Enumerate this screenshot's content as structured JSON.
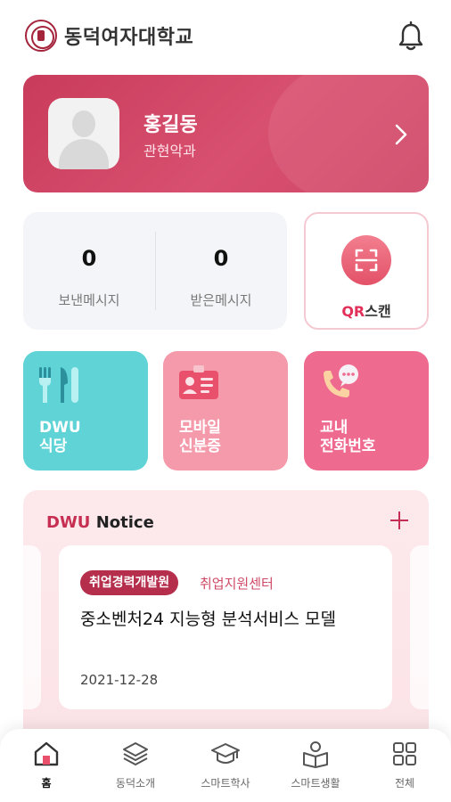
{
  "header": {
    "title": "동덕여자대학교",
    "logo": "university-seal",
    "bell_icon": "bell-icon"
  },
  "profile": {
    "name": "홍길동",
    "department": "관현악과",
    "color": "#d0476a"
  },
  "messages": {
    "sent": {
      "count": "0",
      "label": "보낸메시지"
    },
    "received": {
      "count": "0",
      "label": "받은메시지"
    }
  },
  "qr": {
    "accent": "QR",
    "label": "스캔",
    "icon": "qr-scan-icon"
  },
  "tiles": [
    {
      "line1": "DWU",
      "line2": "식당",
      "icon": "fork-knife-icon",
      "color": "#5fd3d6"
    },
    {
      "line1": "모바일",
      "line2": "신분증",
      "icon": "id-card-icon",
      "color": "#f49aab"
    },
    {
      "line1": "교내",
      "line2": "전화번호",
      "icon": "phone-chat-icon",
      "color": "#ef6a8f"
    }
  ],
  "notice": {
    "title_accent": "DWU",
    "title": "Notice",
    "item": {
      "badge": "취업경력개발원",
      "category": "취업지원센터",
      "headline": "중소벤처24 지능형 분석서비스 모델",
      "date": "2021-12-28"
    }
  },
  "nav": [
    {
      "label": "홈",
      "icon": "home-icon",
      "active": true
    },
    {
      "label": "동덕소개",
      "icon": "layers-icon"
    },
    {
      "label": "스마트학사",
      "icon": "graduation-cap-icon"
    },
    {
      "label": "스마트생활",
      "icon": "person-book-icon"
    },
    {
      "label": "전체",
      "icon": "grid-icon"
    }
  ]
}
